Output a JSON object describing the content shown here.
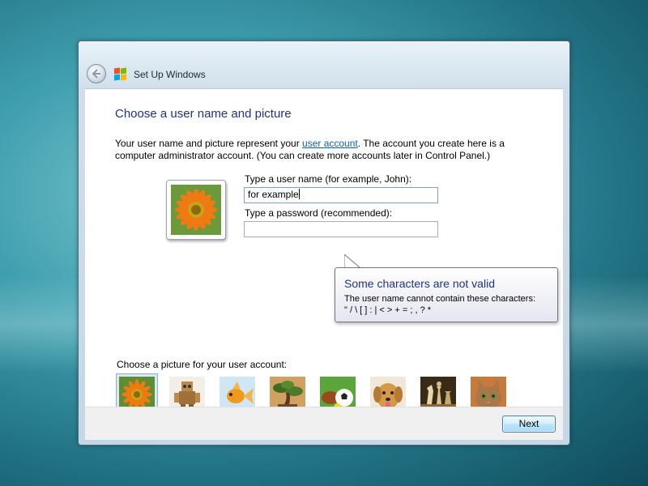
{
  "window": {
    "title": "Set Up Windows"
  },
  "page": {
    "heading": "Choose a user name and picture",
    "description_part1": "Your user name and picture represent your ",
    "description_link": "user account",
    "description_part2": ". The account you create here is a computer administrator account. (You can create more accounts later in Control Panel.)"
  },
  "form": {
    "username_label": "Type a user name (for example, John):",
    "username_value": "for example",
    "password_label": "Type a password (recommended):",
    "password_value": ""
  },
  "tooltip": {
    "title": "Some characters are not valid",
    "line1": "The user name cannot contain these characters:",
    "line2": "\" / \\ [ ] : | < > + = ; , ? *"
  },
  "pictures": {
    "label": "Choose a picture for your user account:",
    "items": [
      {
        "name": "orange-flower-picture",
        "selected": true
      },
      {
        "name": "robot-picture",
        "selected": false
      },
      {
        "name": "goldfish-picture",
        "selected": false
      },
      {
        "name": "bonsai-tree-picture",
        "selected": false
      },
      {
        "name": "sports-balls-picture",
        "selected": false
      },
      {
        "name": "puppy-picture",
        "selected": false
      },
      {
        "name": "chess-pieces-picture",
        "selected": false
      },
      {
        "name": "kitten-picture",
        "selected": false
      }
    ]
  },
  "footer": {
    "next_label": "Next"
  },
  "icons": {
    "back": "back-arrow-icon",
    "windows_logo": "windows-logo-icon"
  },
  "colors": {
    "heading": "#1e3287",
    "link": "#0b5fb4",
    "tooltip_title": "#1e3287"
  }
}
